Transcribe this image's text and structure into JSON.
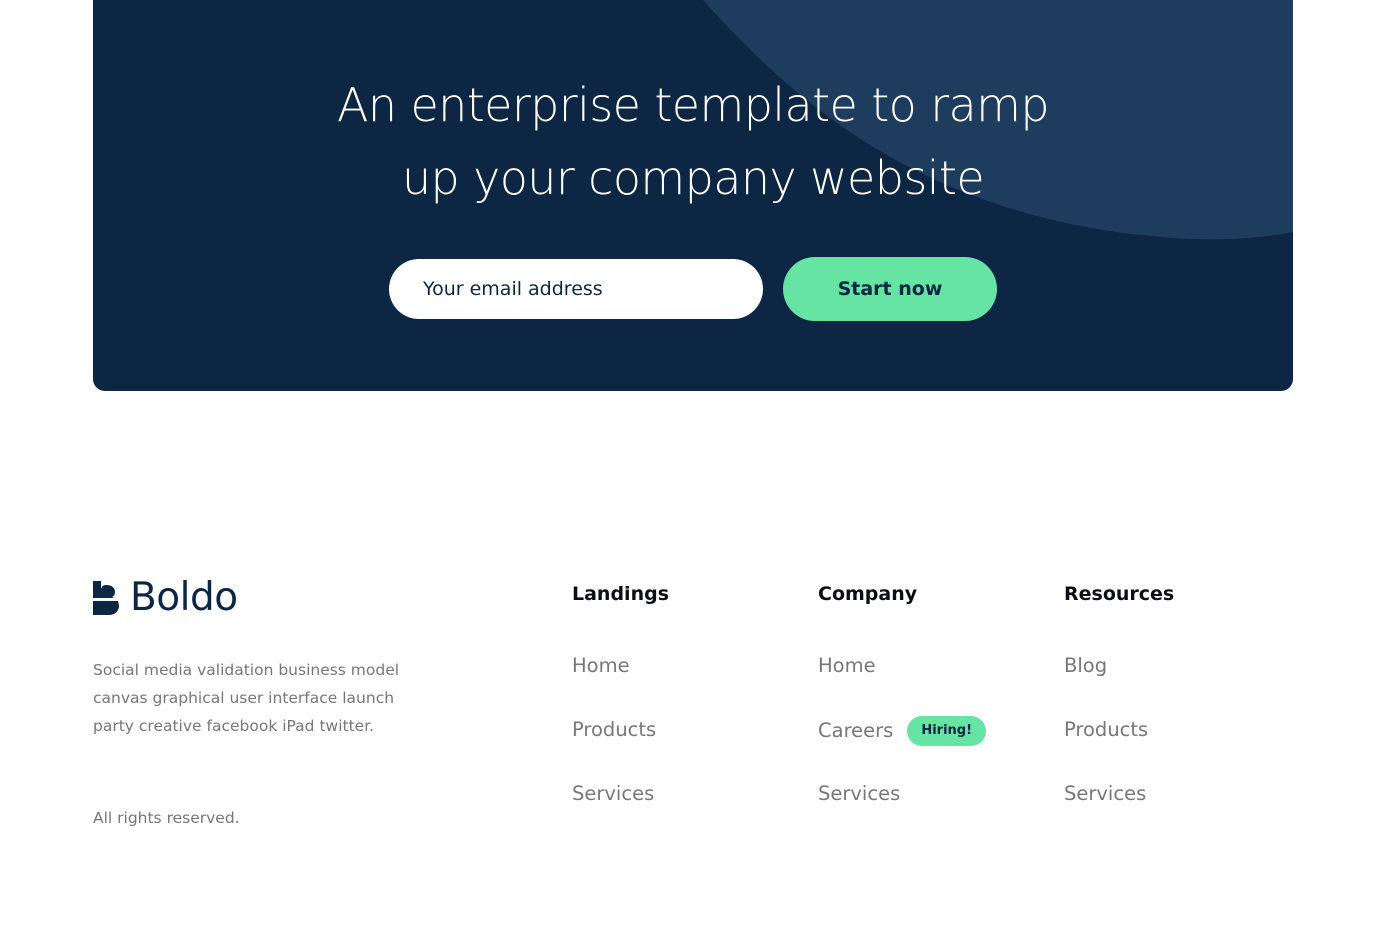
{
  "cta": {
    "title_line1": "An enterprise template to ramp",
    "title_line2": "up your company website",
    "email_placeholder": "Your email address",
    "button_label": "Start now"
  },
  "brand": {
    "name": "Boldo",
    "icon": "boldo-logo-icon"
  },
  "footer": {
    "about": "Social media validation business model canvas graphical user interface launch party creative facebook iPad twitter.",
    "rights": "All rights reserved.",
    "columns": [
      {
        "heading": "Landings",
        "links": [
          {
            "label": "Home"
          },
          {
            "label": "Products"
          },
          {
            "label": "Services"
          }
        ]
      },
      {
        "heading": "Company",
        "links": [
          {
            "label": "Home"
          },
          {
            "label": "Careers",
            "badge": "Hiring!"
          },
          {
            "label": "Services"
          }
        ]
      },
      {
        "heading": "Resources",
        "links": [
          {
            "label": "Blog"
          },
          {
            "label": "Products"
          },
          {
            "label": "Services"
          }
        ]
      }
    ]
  },
  "colors": {
    "navy": "#0c2643",
    "accent_shape": "#1e3d5e",
    "green": "#65e4a3",
    "muted_text": "#777777"
  }
}
